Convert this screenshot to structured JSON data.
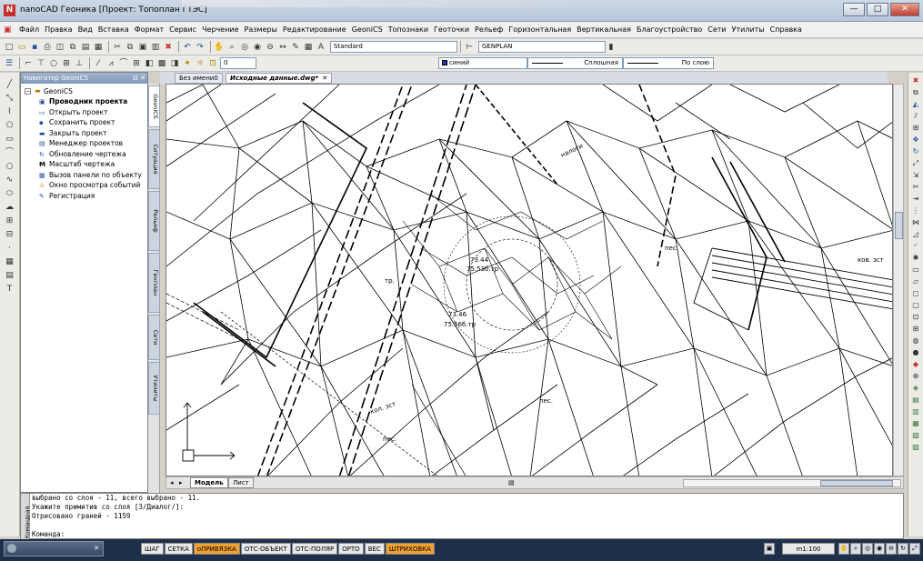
{
  "window": {
    "title": "nanoCAD Геоника [Проект: Топоплан ГТЭС]",
    "buttons": [
      "—",
      "□",
      "✕"
    ]
  },
  "menu": [
    "Файл",
    "Правка",
    "Вид",
    "Вставка",
    "Формат",
    "Сервис",
    "Черчение",
    "Размеры",
    "Редактирование",
    "GeoniCS",
    "Топознаки",
    "Геоточки",
    "Рельеф",
    "Горизонтальная",
    "Вертикальная",
    "Благоустройство",
    "Сети",
    "Утилиты",
    "Справка"
  ],
  "toolbar": {
    "text_style": "Standard",
    "layer_name": "GENPLAN",
    "current_layer": "0",
    "color": "синий",
    "linetype": "Сплошная",
    "lineweight": "По слою"
  },
  "navigator": {
    "title": "Навигатор GeoniCS",
    "root": "GeoniCS",
    "items": [
      {
        "label": "Проводник проекта",
        "icon": "project-explorer-icon"
      },
      {
        "label": "Открыть проект",
        "icon": "open-folder-icon"
      },
      {
        "label": "Сохранить проект",
        "icon": "save-icon"
      },
      {
        "label": "Закрыть проект",
        "icon": "close-project-icon"
      },
      {
        "label": "Менеджер проектов",
        "icon": "manager-icon"
      },
      {
        "label": "Обновление чертежа",
        "icon": "refresh-icon"
      },
      {
        "label": "Масштаб чертежа",
        "icon": "scale-icon"
      },
      {
        "label": "Вызов панели по объекту",
        "icon": "panel-icon"
      },
      {
        "label": "Окно просмотра событий",
        "icon": "event-log-icon"
      },
      {
        "label": "Регистрация",
        "icon": "registration-icon"
      }
    ]
  },
  "side_tabs": [
    "GeoniCS",
    "Ситуация",
    "Рельеф",
    "Генплан",
    "Сети",
    "Утилиты"
  ],
  "doc_tabs": [
    {
      "label": "Без имени0"
    },
    {
      "label": "Исходные данные.dwg*"
    }
  ],
  "layout_tabs": [
    "Модель",
    "Лист"
  ],
  "drawing_labels": {
    "pes": "пес.",
    "kol_zst": "кол. зст",
    "kov_zst": "ков. зст",
    "elev1_a": "73.44",
    "elev1_b": "75.53б.тр",
    "elev2_a": "73.46",
    "elev2_b": "75.56б.тр",
    "napravl": "налоги",
    "tri": "тр."
  },
  "command": {
    "lines": [
      "выбрано со слоя - 11, всего выбрано - 11.",
      "Укажите примитив со слоя [З/Диалог/]:",
      "Отрисовано граней - 1159",
      "",
      "Команда:"
    ],
    "side_label": "Командная"
  },
  "taskbar": {
    "close": "✕"
  },
  "status": {
    "buttons": [
      {
        "label": "ШАГ",
        "on": false
      },
      {
        "label": "СЕТКА",
        "on": false
      },
      {
        "label": "оПРИВЯЗКА",
        "on": true
      },
      {
        "label": "ОТС-ОБЪЕКТ",
        "on": false
      },
      {
        "label": "ОТС-ПОЛЯР",
        "on": false
      },
      {
        "label": "ОРТО",
        "on": false
      },
      {
        "label": "ВЕС",
        "on": false
      },
      {
        "label": "ШТРИХОВКА",
        "on": true
      }
    ],
    "scale": "m1:100"
  },
  "colors": {
    "accent": "#f0a030",
    "title_gradient": "#b7c7da",
    "drawing_line": "#000000"
  }
}
